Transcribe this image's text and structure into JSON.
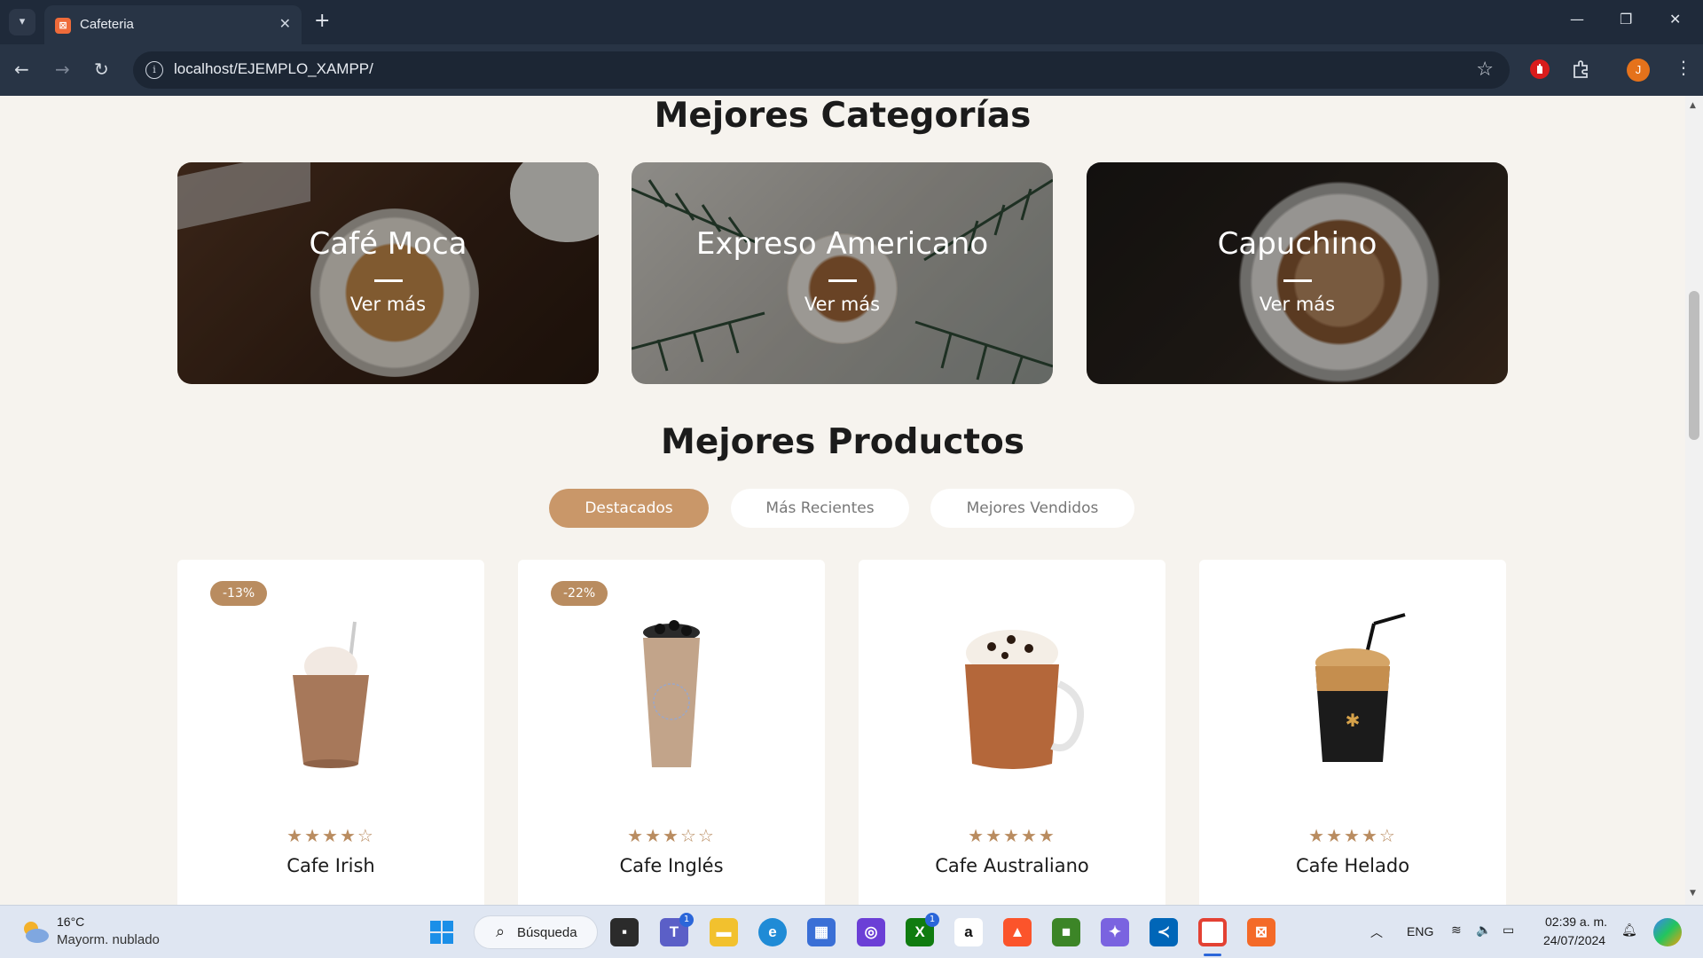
{
  "browser": {
    "tab_title": "Cafeteria",
    "url": "localhost/EJEMPLO_XAMPP/",
    "profile_initial": "J"
  },
  "page": {
    "categories_title": "Mejores Categorías",
    "categories": [
      {
        "title": "Café Moca",
        "link": "Ver más"
      },
      {
        "title": "Expreso Americano",
        "link": "Ver más"
      },
      {
        "title": "Capuchino",
        "link": "Ver más"
      }
    ],
    "products_title": "Mejores Productos",
    "filters": [
      {
        "label": "Destacados",
        "active": true
      },
      {
        "label": "Más Recientes",
        "active": false
      },
      {
        "label": "Mejores Vendidos",
        "active": false
      }
    ],
    "products": [
      {
        "name": "Cafe Irish",
        "badge": "-13%",
        "rating": 4,
        "stars": "★★★★☆"
      },
      {
        "name": "Cafe Inglés",
        "badge": "-22%",
        "rating": 3,
        "stars": "★★★☆☆"
      },
      {
        "name": "Cafe Australiano",
        "badge": "",
        "rating": 5,
        "stars": "★★★★★"
      },
      {
        "name": "Cafe Helado",
        "badge": "",
        "rating": 4,
        "stars": "★★★★☆"
      }
    ]
  },
  "taskbar": {
    "weather_temp": "16°C",
    "weather_desc": "Mayorm. nublado",
    "search_label": "Búsqueda",
    "language": "ENG",
    "time": "02:39 a. m.",
    "date": "24/07/2024",
    "teams_badge": "1",
    "xbox_badge": "1"
  },
  "colors": {
    "accent": "#c99769",
    "badge": "#b98c60",
    "page_bg": "#f6f3ee",
    "chrome_dark": "#1f2a3a"
  }
}
